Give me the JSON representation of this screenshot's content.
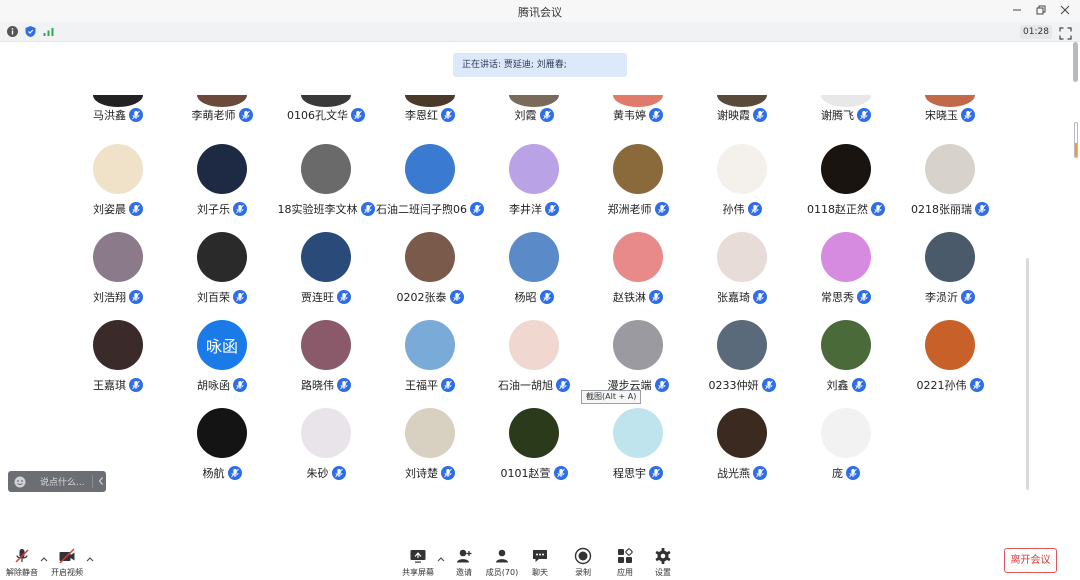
{
  "window": {
    "title": "腾讯会议",
    "timer": "01:28"
  },
  "speaking": {
    "text": "正在讲话: 贾延迪; 刘雁春;"
  },
  "tooltip": {
    "text": "截图(Alt + A)"
  },
  "chat": {
    "placeholder": "说点什么..."
  },
  "recording_progress": 0.4,
  "colors": {
    "accent": "#2f6ee6",
    "leave": "#d83b3b",
    "banner": "#dbe9fb",
    "mic_badge": "#2f6ee6"
  },
  "participants": [
    {
      "name": "马洪鑫",
      "row": 0,
      "col": 0,
      "av": "#222222"
    },
    {
      "name": "李萌老师",
      "row": 0,
      "col": 1,
      "av": "#6b4a3c"
    },
    {
      "name": "0106孔文华",
      "row": 0,
      "col": 2,
      "av": "#3a3a3a"
    },
    {
      "name": "李恩红",
      "row": 0,
      "col": 3,
      "av": "#4a3a2a"
    },
    {
      "name": "刘霞",
      "row": 0,
      "col": 4,
      "av": "#7a6a5a"
    },
    {
      "name": "黄韦婷",
      "row": 0,
      "col": 5,
      "av": "#e07a6a"
    },
    {
      "name": "谢映霞",
      "row": 0,
      "col": 6,
      "av": "#5a4a3a"
    },
    {
      "name": "谢腾飞",
      "row": 0,
      "col": 7,
      "av": "#e8e8e8"
    },
    {
      "name": "宋晓玉",
      "row": 0,
      "col": 8,
      "av": "#c06a4a"
    },
    {
      "name": "刘姿晨",
      "row": 1,
      "col": 0,
      "av": "#f0e2c8"
    },
    {
      "name": "刘子乐",
      "row": 1,
      "col": 1,
      "av": "#1e2a44"
    },
    {
      "name": "18实验班李文林",
      "row": 1,
      "col": 2,
      "av": "#6a6a6a"
    },
    {
      "name": "石油二班闫子煦06",
      "row": 1,
      "col": 3,
      "av": "#3a7ad0"
    },
    {
      "name": "李井洋",
      "row": 1,
      "col": 4,
      "av": "#b9a3e6"
    },
    {
      "name": "郑洲老师",
      "row": 1,
      "col": 5,
      "av": "#8a6a3a"
    },
    {
      "name": "孙伟",
      "row": 1,
      "col": 6,
      "av": "#f4f0ec"
    },
    {
      "name": "0118赵正然",
      "row": 1,
      "col": 7,
      "av": "#1a1410"
    },
    {
      "name": "0218张丽瑞",
      "row": 1,
      "col": 8,
      "av": "#d8d2cc"
    },
    {
      "name": "刘浩翔",
      "row": 2,
      "col": 0,
      "av": "#8a7a8a"
    },
    {
      "name": "刘百荣",
      "row": 2,
      "col": 1,
      "av": "#2a2a2a"
    },
    {
      "name": "贾连旺",
      "row": 2,
      "col": 2,
      "av": "#2a4a7a"
    },
    {
      "name": "0202张泰",
      "row": 2,
      "col": 3,
      "av": "#7a5a4a"
    },
    {
      "name": "杨昭",
      "row": 2,
      "col": 4,
      "av": "#5a8ac8"
    },
    {
      "name": "赵铁淋",
      "row": 2,
      "col": 5,
      "av": "#e88a8a"
    },
    {
      "name": "张嘉琦",
      "row": 2,
      "col": 6,
      "av": "#e8dcd8"
    },
    {
      "name": "常思秀",
      "row": 2,
      "col": 7,
      "av": "#d68ae0"
    },
    {
      "name": "李涢沂",
      "row": 2,
      "col": 8,
      "av": "#4a5a6a"
    },
    {
      "name": "王嘉琪",
      "row": 3,
      "col": 0,
      "av": "#3a2a2a"
    },
    {
      "name": "胡咏函",
      "row": 3,
      "col": 1,
      "av": "#1a7ae8",
      "text": "咏函"
    },
    {
      "name": "路晓伟",
      "row": 3,
      "col": 2,
      "av": "#8a5a6a"
    },
    {
      "name": "王福平",
      "row": 3,
      "col": 3,
      "av": "#7aaad8"
    },
    {
      "name": "石油一胡旭",
      "row": 3,
      "col": 4,
      "av": "#f0d8d0"
    },
    {
      "name": "漫步云端",
      "row": 3,
      "col": 5,
      "av": "#9a9aa0"
    },
    {
      "name": "0233仲妍",
      "row": 3,
      "col": 6,
      "av": "#5a6a7a"
    },
    {
      "name": "刘鑫",
      "row": 3,
      "col": 7,
      "av": "#4a6a3a"
    },
    {
      "name": "0221孙伟",
      "row": 3,
      "col": 8,
      "av": "#c8602a"
    },
    {
      "name": "杨航",
      "row": 4,
      "col": 1,
      "av": "#141414"
    },
    {
      "name": "朱砂",
      "row": 4,
      "col": 2,
      "av": "#e8e4ea"
    },
    {
      "name": "刘诗楚",
      "row": 4,
      "col": 3,
      "av": "#d8d0c0"
    },
    {
      "name": "0101赵萱",
      "row": 4,
      "col": 4,
      "av": "#2a3a1a"
    },
    {
      "name": "程思宇",
      "row": 4,
      "col": 5,
      "av": "#bfe4ee"
    },
    {
      "name": "战光燕",
      "row": 4,
      "col": 6,
      "av": "#3a2a20"
    },
    {
      "name": "庞",
      "row": 4,
      "col": 7,
      "av": "#f2f2f2"
    }
  ],
  "toolbar": {
    "mute": "解除静音",
    "video": "开启视频",
    "share": "共享屏幕",
    "invite": "邀请",
    "members": "成员(70)",
    "chat": "聊天",
    "record": "录制",
    "apps": "应用",
    "settings": "设置",
    "leave": "离开会议"
  }
}
